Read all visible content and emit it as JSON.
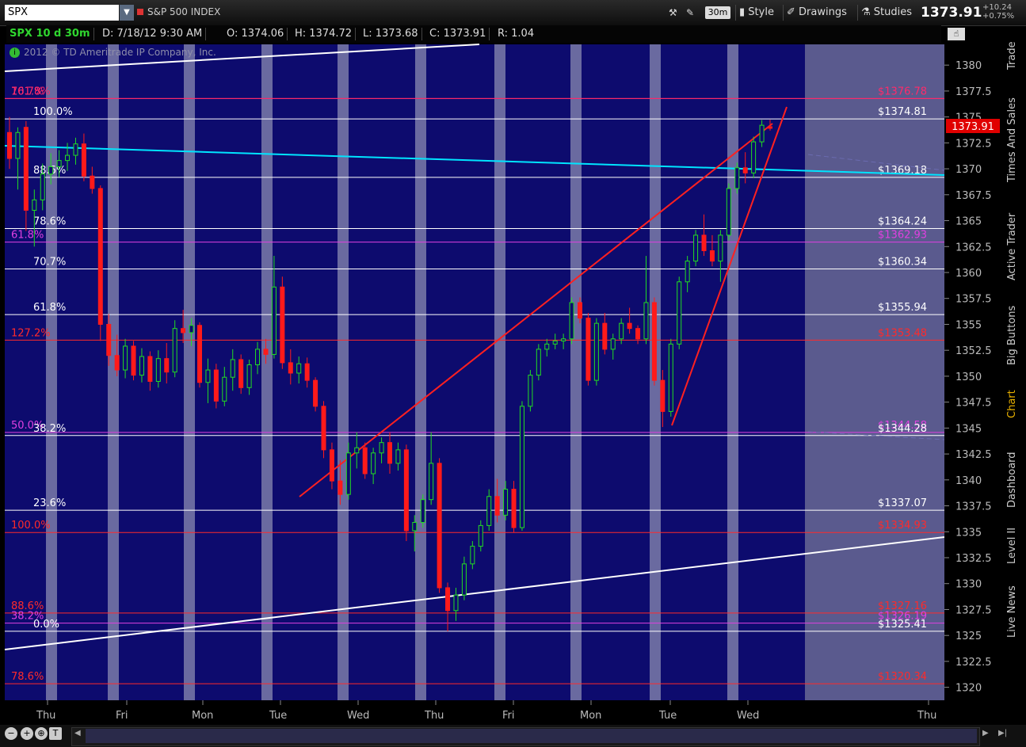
{
  "toolbar": {
    "symbol": "SPX",
    "instrument_name": "S&P 500 INDEX",
    "aggregation": "30m",
    "style_label": "Style",
    "drawings_label": "Drawings",
    "studies_label": "Studies",
    "last_price": "1373.91",
    "change": "+10.24",
    "change_pct": "+0.75%"
  },
  "info_bar": {
    "symbol_period": "SPX 10 d 30m",
    "datetime": "D: 7/18/12 9:30 AM",
    "open": "O: 1374.06",
    "high": "H: 1374.72",
    "low": "L: 1373.68",
    "close": "C: 1373.91",
    "range": "R: 1.04"
  },
  "copyright": "2012 © TD Ameritrade IP Company, Inc.",
  "price_axis": {
    "min": 1318.75,
    "max": 1382,
    "ticks": [
      1380,
      1377.5,
      1375,
      1372.5,
      1370,
      1367.5,
      1365,
      1362.5,
      1360,
      1357.5,
      1355,
      1352.5,
      1350,
      1347.5,
      1345,
      1342.5,
      1340,
      1337.5,
      1335,
      1332.5,
      1330,
      1327.5,
      1325,
      1322.5,
      1320
    ]
  },
  "price_tag": "1373.91",
  "day_labels": [
    "Thu",
    "Fri",
    "Mon",
    "Tue",
    "Wed",
    "Thu",
    "Fri",
    "Mon",
    "Tue",
    "Wed",
    "Thu"
  ],
  "fib_levels": [
    {
      "label": "161.8%",
      "price_label": "$1376.78",
      "price": 1376.78,
      "color": "#ff2a6a"
    },
    {
      "label": "70.7%",
      "price_label": "",
      "price": 1376.78,
      "color": "#ff2a6a"
    },
    {
      "label": "100.0%",
      "price_label": "$1374.81",
      "price": 1374.81,
      "color": "#ffffff"
    },
    {
      "label": "88.6%",
      "price_label": "$1369.18",
      "price": 1369.18,
      "color": "#ffffff"
    },
    {
      "label": "78.6%",
      "price_label": "$1364.24",
      "price": 1364.24,
      "color": "#ffffff"
    },
    {
      "label": "61.8%",
      "price_label": "$1362.93",
      "price": 1362.93,
      "color": "#e040e0"
    },
    {
      "label": "70.7%",
      "price_label": "$1360.34",
      "price": 1360.34,
      "color": "#ffffff"
    },
    {
      "label": "61.8%",
      "price_label": "$1355.94",
      "price": 1355.94,
      "color": "#ffffff"
    },
    {
      "label": "127.2%",
      "price_label": "$1353.48",
      "price": 1353.48,
      "color": "#ff2a2a"
    },
    {
      "label": "50.0%",
      "price_label": "$1344.58",
      "price": 1344.58,
      "color": "#e040e0"
    },
    {
      "label": "38.2%",
      "price_label": "$1344.28",
      "price": 1344.28,
      "color": "#ffffff"
    },
    {
      "label": "23.6%",
      "price_label": "$1337.07",
      "price": 1337.07,
      "color": "#ffffff"
    },
    {
      "label": "100.0%",
      "price_label": "$1334.93",
      "price": 1334.93,
      "color": "#ff2a2a"
    },
    {
      "label": "88.6%",
      "price_label": "$1327.16",
      "price": 1327.16,
      "color": "#ff2a2a"
    },
    {
      "label": "38.2%",
      "price_label": "$1326.19",
      "price": 1326.19,
      "color": "#e040e0"
    },
    {
      "label": "0.0%",
      "price_label": "$1325.41",
      "price": 1325.41,
      "color": "#ffffff"
    },
    {
      "label": "78.6%",
      "price_label": "$1320.34",
      "price": 1320.34,
      "color": "#ff2a2a"
    }
  ],
  "side_tabs": [
    "Trade",
    "Times And Sales",
    "Active Trader",
    "Big Buttons",
    "Chart",
    "Dashboard",
    "Level II",
    "Live News"
  ],
  "active_tab": "Chart",
  "chart_data": {
    "type": "candlestick",
    "title": "",
    "symbol": "SPX",
    "aggregation": "30m",
    "ylim": [
      1318.75,
      1382
    ],
    "xlabel": "",
    "ylabel": "",
    "candles": [
      [
        1373.5,
        1375.0,
        1370.0,
        1371.0
      ],
      [
        1371.0,
        1374.0,
        1368.0,
        1373.5
      ],
      [
        1374.0,
        1374.6,
        1364.0,
        1366.0
      ],
      [
        1366.0,
        1368.0,
        1362.5,
        1367.0
      ],
      [
        1367.0,
        1370.5,
        1366.0,
        1369.5
      ],
      [
        1369.5,
        1371.5,
        1368.5,
        1370.2
      ],
      [
        1370.2,
        1371.8,
        1369.2,
        1370.8
      ],
      [
        1370.8,
        1372.5,
        1369.8,
        1371.3
      ],
      [
        1371.3,
        1373.0,
        1370.4,
        1372.4
      ],
      [
        1372.4,
        1373.4,
        1368.8,
        1369.3
      ],
      [
        1369.3,
        1370.2,
        1367.6,
        1368.1
      ],
      [
        1368.1,
        1368.4,
        1353.4,
        1355.0
      ],
      [
        1355.0,
        1356.0,
        1351.0,
        1352.0
      ],
      [
        1352.0,
        1354.0,
        1350.0,
        1350.6
      ],
      [
        1350.6,
        1353.6,
        1349.8,
        1352.9
      ],
      [
        1352.9,
        1353.4,
        1349.6,
        1350.1
      ],
      [
        1350.1,
        1352.7,
        1349.4,
        1351.9
      ],
      [
        1351.9,
        1352.4,
        1348.6,
        1349.5
      ],
      [
        1349.5,
        1352.5,
        1348.9,
        1351.7
      ],
      [
        1351.7,
        1353.2,
        1349.3,
        1350.4
      ],
      [
        1350.4,
        1355.4,
        1349.9,
        1354.6
      ],
      [
        1354.6,
        1356.4,
        1353.2,
        1354.2
      ],
      [
        1354.2,
        1355.6,
        1352.9,
        1354.9
      ],
      [
        1354.9,
        1355.2,
        1348.9,
        1349.4
      ],
      [
        1349.4,
        1351.7,
        1347.4,
        1350.6
      ],
      [
        1350.6,
        1351.2,
        1346.9,
        1347.6
      ],
      [
        1347.6,
        1350.9,
        1347.1,
        1349.9
      ],
      [
        1349.9,
        1352.6,
        1348.6,
        1351.6
      ],
      [
        1351.6,
        1352.1,
        1348.3,
        1348.9
      ],
      [
        1348.9,
        1351.6,
        1348.2,
        1351.1
      ],
      [
        1351.1,
        1353.3,
        1350.2,
        1352.6
      ],
      [
        1352.6,
        1353.6,
        1351.2,
        1352.1
      ],
      [
        1352.1,
        1361.6,
        1351.7,
        1358.6
      ],
      [
        1358.6,
        1359.6,
        1350.7,
        1351.3
      ],
      [
        1351.3,
        1352.6,
        1349.2,
        1350.3
      ],
      [
        1350.3,
        1351.9,
        1349.3,
        1351.2
      ],
      [
        1351.2,
        1351.8,
        1348.9,
        1349.6
      ],
      [
        1349.6,
        1349.9,
        1346.6,
        1347.1
      ],
      [
        1347.1,
        1347.6,
        1342.1,
        1342.9
      ],
      [
        1342.9,
        1343.6,
        1339.1,
        1339.9
      ],
      [
        1339.9,
        1341.9,
        1337.6,
        1338.6
      ],
      [
        1338.6,
        1343.6,
        1338.1,
        1342.6
      ],
      [
        1342.6,
        1344.6,
        1341.1,
        1343.1
      ],
      [
        1343.1,
        1343.6,
        1340.1,
        1340.6
      ],
      [
        1340.6,
        1343.1,
        1339.6,
        1342.6
      ],
      [
        1342.6,
        1344.1,
        1341.6,
        1343.6
      ],
      [
        1343.6,
        1344.6,
        1340.6,
        1341.6
      ],
      [
        1341.6,
        1343.6,
        1340.9,
        1342.9
      ],
      [
        1342.9,
        1343.4,
        1334.1,
        1335.1
      ],
      [
        1335.1,
        1336.6,
        1333.1,
        1335.9
      ],
      [
        1335.9,
        1338.6,
        1335.4,
        1338.1
      ],
      [
        1338.1,
        1344.6,
        1337.6,
        1341.6
      ],
      [
        1341.6,
        1342.1,
        1329.1,
        1329.6
      ],
      [
        1329.6,
        1330.1,
        1325.4,
        1327.4
      ],
      [
        1327.4,
        1329.6,
        1326.4,
        1328.9
      ],
      [
        1328.9,
        1332.6,
        1328.4,
        1331.9
      ],
      [
        1331.9,
        1334.1,
        1331.4,
        1333.6
      ],
      [
        1333.6,
        1336.1,
        1333.1,
        1335.6
      ],
      [
        1335.6,
        1339.1,
        1335.1,
        1338.4
      ],
      [
        1338.4,
        1340.1,
        1335.9,
        1336.6
      ],
      [
        1336.6,
        1339.9,
        1336.1,
        1339.1
      ],
      [
        1339.1,
        1339.9,
        1334.9,
        1335.4
      ],
      [
        1335.4,
        1347.6,
        1335.1,
        1347.1
      ],
      [
        1347.1,
        1350.6,
        1346.6,
        1350.1
      ],
      [
        1350.1,
        1353.1,
        1349.6,
        1352.6
      ],
      [
        1352.6,
        1353.6,
        1351.9,
        1353.1
      ],
      [
        1353.1,
        1354.1,
        1352.6,
        1353.4
      ],
      [
        1353.4,
        1354.1,
        1352.6,
        1353.6
      ],
      [
        1353.6,
        1357.6,
        1353.1,
        1357.1
      ],
      [
        1357.1,
        1357.6,
        1355.1,
        1355.6
      ],
      [
        1355.6,
        1356.1,
        1349.1,
        1349.6
      ],
      [
        1349.6,
        1355.6,
        1349.1,
        1355.1
      ],
      [
        1355.1,
        1356.1,
        1352.1,
        1352.6
      ],
      [
        1352.6,
        1354.1,
        1351.6,
        1353.6
      ],
      [
        1353.6,
        1355.6,
        1353.1,
        1355.1
      ],
      [
        1355.1,
        1356.6,
        1354.1,
        1354.6
      ],
      [
        1354.6,
        1354.9,
        1353.1,
        1353.6
      ],
      [
        1353.6,
        1361.6,
        1353.1,
        1357.1
      ],
      [
        1357.1,
        1357.6,
        1349.1,
        1349.6
      ],
      [
        1349.6,
        1350.6,
        1345.1,
        1346.6
      ],
      [
        1346.6,
        1353.6,
        1346.1,
        1353.1
      ],
      [
        1353.1,
        1359.6,
        1352.6,
        1359.1
      ],
      [
        1359.1,
        1361.6,
        1358.1,
        1361.1
      ],
      [
        1361.1,
        1364.1,
        1360.6,
        1363.6
      ],
      [
        1363.6,
        1365.6,
        1361.6,
        1362.1
      ],
      [
        1362.1,
        1363.6,
        1360.6,
        1361.1
      ],
      [
        1361.1,
        1364.1,
        1359.1,
        1363.6
      ],
      [
        1363.6,
        1368.6,
        1363.1,
        1368.1
      ],
      [
        1368.1,
        1370.6,
        1367.6,
        1370.1
      ],
      [
        1370.1,
        1371.6,
        1368.6,
        1369.6
      ],
      [
        1369.6,
        1373.1,
        1369.1,
        1372.6
      ],
      [
        1372.6,
        1374.7,
        1372.1,
        1374.2
      ],
      [
        1374.06,
        1374.72,
        1373.68,
        1373.91
      ]
    ]
  }
}
